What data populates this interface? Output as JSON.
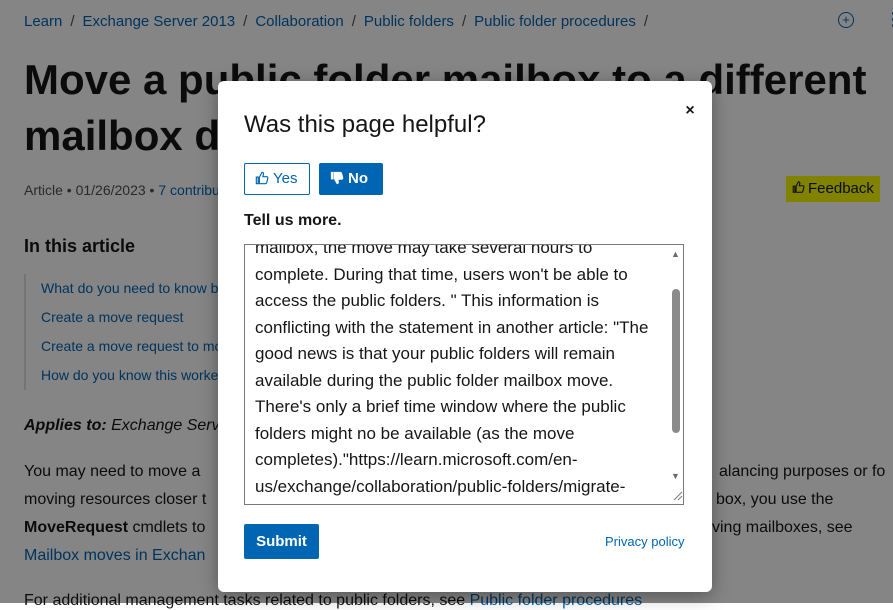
{
  "breadcrumb": {
    "items": [
      "Learn",
      "Exchange Server 2013",
      "Collaboration",
      "Public folders",
      "Public folder procedures"
    ],
    "separator": "/"
  },
  "article": {
    "title": "Move a public folder mailbox to a different mailbox database",
    "meta_type": "Article",
    "meta_date": "01/26/2023",
    "meta_contributors": "7 contributors",
    "feedback_label": "Feedback",
    "toc_title": "In this article",
    "toc_items": [
      "What do you need to know before you begin?",
      "Create a move request",
      "Create a move request to move a public folder mailbox",
      "How do you know this worked?"
    ],
    "applies_label": "Applies to:",
    "applies_value": "Exchange Server 2013",
    "body_line1_left": "You may need to move a",
    "body_line1_right": "alancing purposes or fo",
    "body_line2_left": "moving resources closer t",
    "body_line2_right": "box, you use the",
    "body_line3_bold": "MoveRequest",
    "body_line3_left": " cmdlets to",
    "body_line3_right": "ving mailboxes, see",
    "body_line4_link": "Mailbox moves in Exchan",
    "body_line5_left": "For additional management tasks related to public folders, see ",
    "body_line5_link": "Public folder procedures"
  },
  "modal": {
    "title": "Was this page helpful?",
    "yes_label": "Yes",
    "no_label": "No",
    "selected": "No",
    "tell_more_label": "Tell us more.",
    "feedback_text": "mailbox, the move may take several hours to complete. During that time, users won't be able to access the public folders. \" This information is conflicting with the statement in another article: \"The good news is that your public folders will remain available during the public folder mailbox move. There's only a brief time window where the public folders might no be available (as the move completes).\"https://learn.microsoft.com/en-us/exchange/collaboration/public-folders/migrate-",
    "submit_label": "Submit",
    "privacy_label": "Privacy policy",
    "close_label": "×"
  },
  "colors": {
    "accent": "#0065b3",
    "highlight": "#f6f900",
    "overlay": "rgba(0,0,0,0.48)"
  },
  "icons": {
    "thumbs_up": "thumbs-up-icon",
    "thumbs_down": "thumbs-down-icon",
    "close": "close-icon",
    "add": "add-circle-icon",
    "more": "more-icon"
  }
}
